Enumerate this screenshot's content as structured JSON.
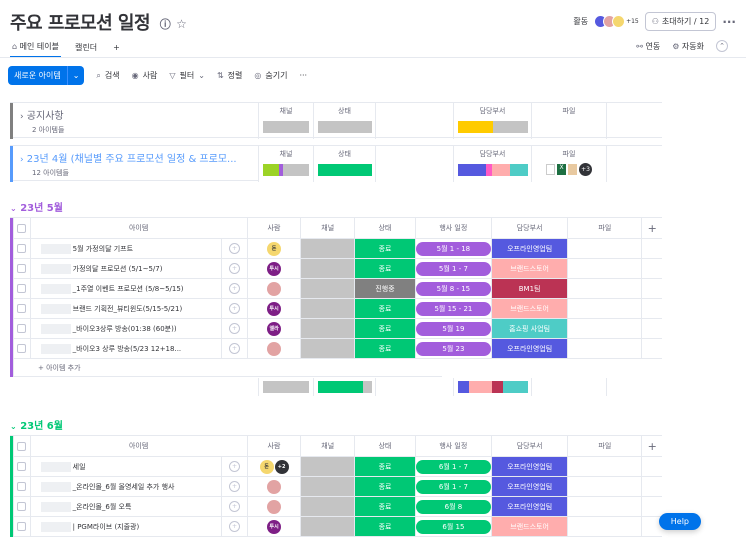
{
  "header": {
    "title": "주요 프로모션 일정",
    "activity_label": "활동",
    "avatar_extra": "+15",
    "invite_label": "초대하기 / 12"
  },
  "tabs": {
    "main": "메인 테이블",
    "calendar": "캘린더",
    "add": "+",
    "integrate": "연동",
    "automate": "자동화"
  },
  "toolbar": {
    "new_item": "새로운 아이템",
    "search": "검색",
    "person": "사람",
    "filter": "필터",
    "sort": "정렬",
    "hide": "숨기기",
    "more": "···"
  },
  "colors": {
    "accent": "#0073ea",
    "done": "#00c875",
    "working": "#808080",
    "group_may": "#a25ddc",
    "group_jun": "#00c875",
    "date_pill": "#00c875",
    "offline": "#5559df",
    "brandstore": "#ffadad",
    "bm": "#bb3354",
    "homeshop": "#4eccc6"
  },
  "collapsed_groups": [
    {
      "name": "공지사항",
      "count": "2 아이템들",
      "color": "#808080",
      "cols": {
        "channel": "채널",
        "status": "상태",
        "dept": "담당부서",
        "file": "파일"
      }
    },
    {
      "name": "23년 4월 (채널별 주요 프로모션 일정 & 프로모...",
      "count": "12 아이템들",
      "color": "#579bfc",
      "cols": {
        "channel": "채널",
        "status": "상태",
        "dept": "담당부서",
        "file": "파일"
      },
      "file_extra": "+3"
    }
  ],
  "group_may": {
    "name": "23년 5월",
    "headers": {
      "item": "아이템",
      "person": "사람",
      "channel": "채널",
      "status": "상태",
      "date": "행사 일정",
      "dept": "담당부서",
      "file": "파일",
      "add": "+"
    },
    "rows": [
      {
        "item": "5월 가정의달 기프트",
        "person": "돈",
        "status": "종료",
        "status_color": "#00c875",
        "date": "5월 1 - 18",
        "dept": "오프라인영업팀",
        "dept_color": "#5559df"
      },
      {
        "item": "가정의달 프로모션 (5/1~5/7)",
        "person": "투시",
        "status": "종료",
        "status_color": "#00c875",
        "date": "5월 1 - 7",
        "dept": "브랜드스토어",
        "dept_color": "#ffadad"
      },
      {
        "item": "_1주열 이벤트 프로모션 (5/8~5/15)",
        "person": "",
        "status": "진행중",
        "status_color": "#808080",
        "date": "5월 8 - 15",
        "dept": "BM1팀",
        "dept_color": "#bb3354"
      },
      {
        "item": "브랜드 기획전_뷰티윈도(5/15-5/21)",
        "person": "투시",
        "status": "종료",
        "status_color": "#00c875",
        "date": "5월 15 - 21",
        "dept": "브랜드스토어",
        "dept_color": "#ffadad"
      },
      {
        "item": "_바이오3상루 방송(01:38 (60분))",
        "person": "엘라",
        "status": "종료",
        "status_color": "#00c875",
        "date": "5월 19",
        "dept": "홈쇼핑 사업팀",
        "dept_color": "#4eccc6"
      },
      {
        "item": "_바이오3 상루 방송(5/23 12+18...",
        "person": "",
        "status": "종료",
        "status_color": "#00c875",
        "date": "5월 23",
        "dept": "오프라인영업팀",
        "dept_color": "#5559df"
      }
    ],
    "add_item": "+ 아이템 추가"
  },
  "group_jun": {
    "name": "23년 6월",
    "headers": {
      "item": "아이템",
      "person": "사람",
      "channel": "채널",
      "status": "상태",
      "date": "행사 일정",
      "dept": "담당부서",
      "file": "파일",
      "add": "+"
    },
    "rows": [
      {
        "item": "세일",
        "person": "돈",
        "person_extra": "+2",
        "status": "종료",
        "status_color": "#00c875",
        "date": "6월 1 - 7",
        "dept": "오프라인영업팀",
        "dept_color": "#5559df"
      },
      {
        "item": "_온라인몰_6월 올영세일 추가 행사",
        "person": "",
        "status": "종료",
        "status_color": "#00c875",
        "date": "6월 1 - 7",
        "dept": "오프라인영업팀",
        "dept_color": "#5559df"
      },
      {
        "item": "_온라인몰_6월 오특",
        "person": "",
        "status": "종료",
        "status_color": "#00c875",
        "date": "6월 8",
        "dept": "오프라인영업팀",
        "dept_color": "#5559df"
      },
      {
        "item": "| PGM라이브 (지줄광)",
        "person": "투시",
        "status": "종료",
        "status_color": "#00c875",
        "date": "6월 15",
        "dept": "브랜드스토어",
        "dept_color": "#ffadad"
      }
    ]
  },
  "help": "Help"
}
